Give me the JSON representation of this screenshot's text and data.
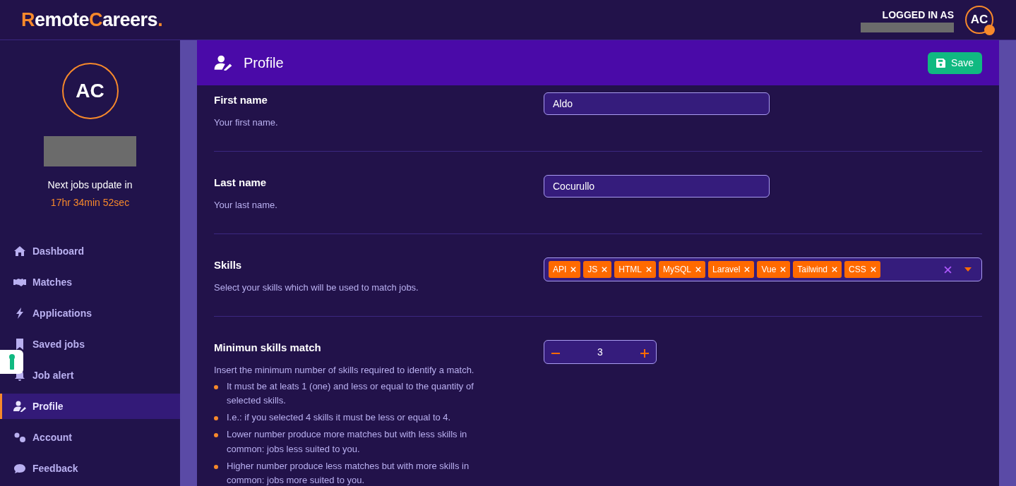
{
  "header": {
    "logo": [
      {
        "text": "R",
        "accent": true
      },
      {
        "text": "emote",
        "accent": false
      },
      {
        "text": "C",
        "accent": true
      },
      {
        "text": "areers",
        "accent": false
      },
      {
        "text": ".",
        "accent": true
      }
    ],
    "logged_in_label": "LOGGED IN AS",
    "avatar": "AC"
  },
  "sidebar": {
    "avatar": "AC",
    "update_label": "Next jobs update in",
    "countdown": "17hr 34min 52sec",
    "items": [
      {
        "label": "Dashboard",
        "selected": false
      },
      {
        "label": "Matches",
        "selected": false
      },
      {
        "label": "Applications",
        "selected": false
      },
      {
        "label": "Saved jobs",
        "selected": false
      },
      {
        "label": "Job alert",
        "selected": false
      },
      {
        "label": "Profile",
        "selected": true
      },
      {
        "label": "Account",
        "selected": false
      },
      {
        "label": "Feedback",
        "selected": false
      }
    ]
  },
  "panel": {
    "title": "Profile",
    "save_button": "Save",
    "fields": [
      {
        "kind": "text",
        "label": "First name",
        "help": "Your first name.",
        "value": "Aldo"
      },
      {
        "kind": "text",
        "label": "Last name",
        "help": "Your last name.",
        "value": "Cocurullo"
      },
      {
        "kind": "tags",
        "label": "Skills",
        "help": "Select your skills which will be used to match jobs.",
        "tags": [
          "API",
          "JS",
          "HTML",
          "MySQL",
          "Laravel",
          "Vue",
          "Tailwind",
          "CSS"
        ]
      },
      {
        "kind": "stepper",
        "label": "Minimun skills match",
        "help": "Insert the minimum number of skills required to identify a match.",
        "value": "3",
        "bullets": [
          "It must be at leats 1 (one) and less or equal to the quantity of selected skills.",
          "I.e.: if you selected 4 skills it must be less or equal to 4.",
          "Lower number produce more matches but with less skills in common: jobs less suited to you.",
          "Higher number produce less matches but with more skills in common: jobs more suited to you."
        ]
      }
    ]
  }
}
